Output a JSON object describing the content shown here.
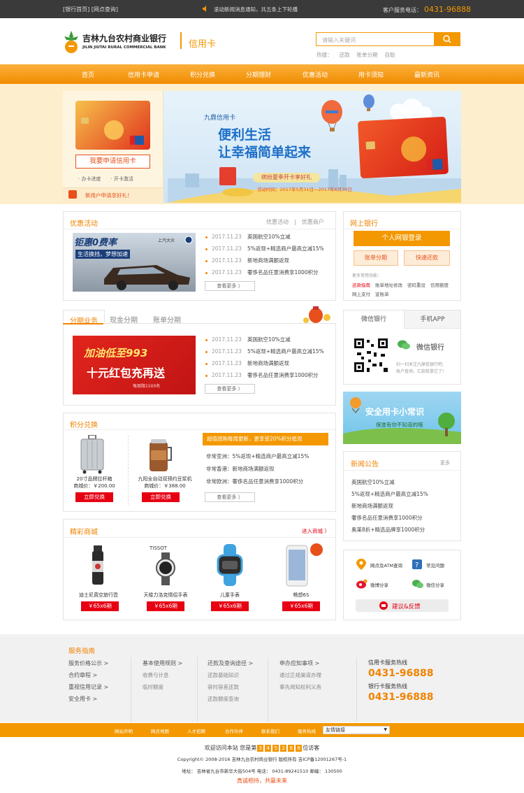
{
  "topbar": {
    "links": "[银行首页] [网点查询]",
    "notice": "滚动新闻消息通知，共五条上下轮播",
    "service_label": "客户服务电话：",
    "service_phone": "0431-96888"
  },
  "header": {
    "bank_cn": "吉林九台农村商业银行",
    "bank_en": "JILIN JIUTAI RURAL COMMERCIAL BANK",
    "section": "信用卡",
    "search_placeholder": "请输入关键词",
    "hot_label": "热搜：",
    "hot_words": [
      "还款",
      "账单分期",
      "自助"
    ]
  },
  "nav": [
    "首页",
    "信用卡申请",
    "积分兑换",
    "分期理财",
    "优惠活动",
    "用卡须知",
    "最新资讯"
  ],
  "banner": {
    "apply_button": "我要申请信用卡",
    "progress_link": "· 办卡进度",
    "activate_link": "· 开卡激活",
    "new_user_promo": "新用户申请享好礼！",
    "card_name": "九鼎信用卡",
    "headline1": "便利生活",
    "headline2": "让幸福简单起来",
    "tag": "缤纷夏季开卡享好礼",
    "date": "活动时间：2017年5月31日—2017年6月30日"
  },
  "promo": {
    "title": "优惠活动",
    "links": [
      "优惠活动",
      "优惠商户"
    ],
    "car_ad_text1": "钜惠0费率",
    "car_ad_text2": "生活换挡，梦想加速",
    "car_brand": "上汽大众",
    "news": [
      {
        "date": "2017.11.23",
        "text": "英国航空10%立减"
      },
      {
        "date": "2017.11.23",
        "text": "5%返现+精选商户最高立减15%"
      },
      {
        "date": "2017.11.23",
        "text": "新地商场满额返现"
      },
      {
        "date": "2017.11.23",
        "text": "奢侈名品任意消费享1000积分"
      }
    ],
    "more": "查看更多 〉"
  },
  "installment": {
    "tabs": [
      "分期业务",
      "现金分期",
      "账单分期"
    ],
    "ad_line1": "加油低至993",
    "ad_line2": "十元红包充再送",
    "ad_note": "每周限1500名",
    "news": [
      {
        "date": "2017.11.23",
        "text": "英国航空10%立减"
      },
      {
        "date": "2017.11.23",
        "text": "5%返现+精选商户最高立减15%"
      },
      {
        "date": "2017.11.23",
        "text": "新地商场满额返现"
      },
      {
        "date": "2017.11.23",
        "text": "奢侈名品任意消费享1000积分"
      }
    ],
    "more": "查看更多 〉"
  },
  "points": {
    "title": "积分兑换",
    "items": [
      {
        "name": "20寸品牌拉杆箱",
        "price": "商城价：￥200.00",
        "btn": "立即兑换"
      },
      {
        "name": "九阳全自动双预约豆浆机",
        "price": "商城价：￥388.00",
        "btn": "立即兑换"
      }
    ],
    "banner": "超值团购每周更新，更享受20%积分抵现",
    "news": [
      {
        "label": "非常亚洲：",
        "text": "5%返现+精选商户最高立减15%"
      },
      {
        "label": "非常香港：",
        "text": "新地商场满额返现"
      },
      {
        "label": "非常欧洲：",
        "text": "奢侈名品任意消费享1000积分"
      }
    ],
    "more": "查看更多 〉"
  },
  "mall": {
    "title": "精彩商城",
    "enter": "进入商城 〉",
    "items": [
      {
        "name": "迪士尼真空旅行壶",
        "btn": "￥65x6期"
      },
      {
        "name": "天梭力洛克情侣手表",
        "btn": "￥65x6期"
      },
      {
        "name": "儿童手表",
        "btn": "￥65x6期"
      },
      {
        "name": "畅想6S",
        "btn": "￥65x6期"
      }
    ]
  },
  "ebank": {
    "title": "网上银行",
    "login": "个人网银登录",
    "btn1": "账单分期",
    "btn2": "快速还款",
    "func_label": "更多常用功能：",
    "funcs_row1": [
      "还款指南",
      "账单地址修改",
      "密码重设",
      "信用额度"
    ],
    "funcs_row2": [
      "网上支付",
      "宣账单"
    ]
  },
  "wechat": {
    "tabs": [
      "微信银行",
      "手机APP"
    ],
    "name": "微信银行",
    "desc1": "扫一扫关注九鼎信银行吧,",
    "desc2": "账户查询，汇款就拿它了!"
  },
  "tips": {
    "title": "安全用卡小常识",
    "subtitle": "保准有你不知道的哦"
  },
  "news": {
    "title": "新闻公告",
    "more": "更多",
    "items": [
      "英国航空10%立减",
      "5%返现+精选商户最高立减15%",
      "新地商场满额返现",
      "奢侈名品任意消费享1000积分",
      "奥莱8折+精选品牌享1000积分"
    ]
  },
  "services": {
    "items": [
      "网点及ATM查询",
      "常见问题",
      "微博分享",
      "微信分享"
    ],
    "feedback": "建议&反馈"
  },
  "footer": {
    "title": "服务指南",
    "col1": [
      "服务价格公示 >",
      "合约章程 >",
      "重视信用记录 >",
      "安全用卡 >"
    ],
    "col2_head": "基本使用规则 >",
    "col2": [
      "收费与计息",
      "临时额度"
    ],
    "col3_head": "还款及查询途径 >",
    "col3": [
      "还款基础知识",
      "容时容差还款",
      "还款额度查询"
    ],
    "col4_head": "申办应知事项 >",
    "col4": [
      "通过正规渠道办理",
      "事先阅知权利义务"
    ],
    "hotline1_label": "信用卡服务热线",
    "hotline1": "0431-96888",
    "hotline2_label": "银行卡服务热线",
    "hotline2": "0431-96888"
  },
  "bottom": {
    "links": [
      "网站声明",
      "网点地图",
      "人才招聘",
      "合作伙伴",
      "联系我们",
      "服务热线"
    ],
    "friend_links": "友情链接",
    "visit_prefix": "欢迎访问本站  您是第",
    "counter": [
      "3",
      "4",
      "5",
      "2",
      "8",
      "6"
    ],
    "visit_suffix": "位访客",
    "copyright": "Copyright© 2008-2016 吉林九台农村商业银行 版权所有 吉ICP备12001267号-1",
    "address": "地址：  吉林省九台市新华大街504号 电话：  0431-89241510 邮编：  130500",
    "slogan": "真诚相待，共赢未来"
  },
  "colors": {
    "accent": "#f39800",
    "red": "#e60012",
    "dark": "#3a3a3a"
  }
}
